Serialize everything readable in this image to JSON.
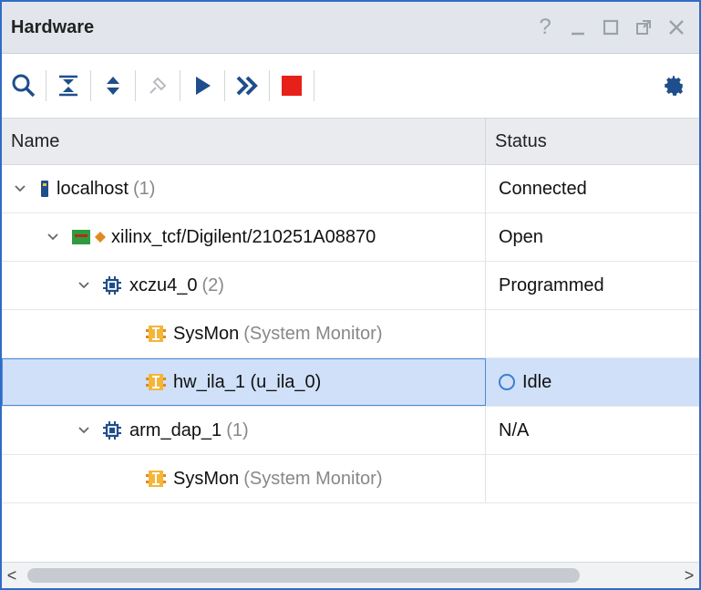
{
  "panel": {
    "title": "Hardware"
  },
  "window_controls": {
    "help": "?",
    "minimize": "_",
    "maximize": "☐",
    "float": "⧉",
    "close": "✕"
  },
  "toolbar": {
    "icons": [
      "search-icon",
      "collapse-all-icon",
      "expand-all-icon",
      "auto-connect-icon",
      "run-trigger-icon",
      "run-immediate-icon",
      "stop-icon",
      "settings-icon"
    ],
    "colors": {
      "stop": "#e8201a",
      "run": "#1f4e8c"
    }
  },
  "columns": {
    "name": "Name",
    "status": "Status"
  },
  "rows": [
    {
      "name": "localhost",
      "count": "(1)",
      "status": "Connected",
      "icon": "server-icon"
    },
    {
      "name": "xilinx_tcf/Digilent/210251A08870",
      "status": "Open",
      "icon": "target-board-icon"
    },
    {
      "name": "xczu4_0",
      "count": "(2)",
      "status": "Programmed",
      "icon": "chip-icon"
    },
    {
      "name": "SysMon",
      "sub": "(System Monitor)",
      "status": "",
      "icon": "sysmon-icon"
    },
    {
      "name": "hw_ila_1 (u_ila_0)",
      "status": "Idle",
      "icon": "ila-icon"
    },
    {
      "name": "arm_dap_1",
      "count": "(1)",
      "status": "N/A",
      "icon": "chip-icon"
    },
    {
      "name": "SysMon",
      "sub": "(System Monitor)",
      "status": "",
      "icon": "sysmon-icon"
    }
  ],
  "scrollbar": {
    "left": "<",
    "right": ">"
  }
}
